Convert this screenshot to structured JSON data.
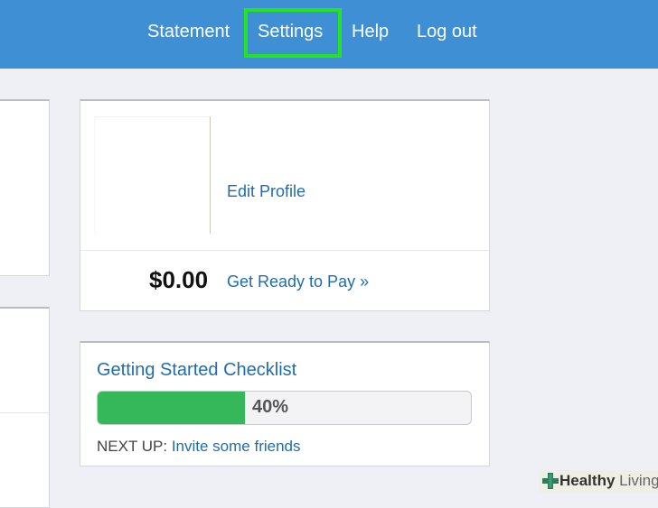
{
  "nav": {
    "items": [
      {
        "label": "Statement"
      },
      {
        "label": "Settings",
        "highlighted": true
      },
      {
        "label": "Help"
      },
      {
        "label": "Log out"
      }
    ]
  },
  "profile": {
    "edit_link": "Edit Profile",
    "balance": "$0.00",
    "pay_link": "Get Ready to Pay »"
  },
  "checklist": {
    "title": "Getting Started Checklist",
    "progress_percent": 40,
    "progress_label": "40%",
    "next_up_label": "NEXT UP:",
    "next_up_link": "Invite some friends"
  },
  "watermark": {
    "brand_bold": "Healthy",
    "brand_light": "Living"
  },
  "colors": {
    "header": "#3e8fd3",
    "highlight": "#22e51e",
    "link": "#1f6dae",
    "progress": "#35b85a",
    "background": "#eef0f5"
  }
}
